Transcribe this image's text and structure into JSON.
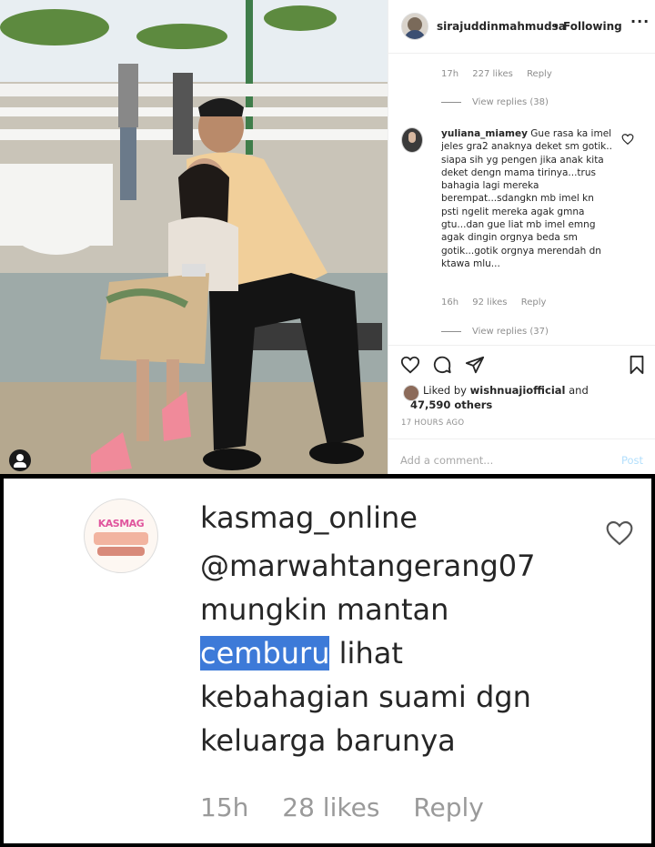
{
  "post": {
    "username": "sirajuddinmahmudsa",
    "separator": "•",
    "follow_status": "Following",
    "more_label": "···"
  },
  "thread": {
    "prev_comment_meta": {
      "time": "17h",
      "likes": "227 likes",
      "reply": "Reply"
    },
    "prev_view_replies": "View replies (38)",
    "comment": {
      "username": "yuliana_miamey",
      "text": "Gue rasa ka imel jeles gra2 anaknya deket sm gotik.. siapa sih yg pengen jika anak kita deket dengn mama tirinya...trus bahagia lagi mereka berempat...sdangkn mb imel kn psti ngelit mereka agak gmna gtu...dan gue liat mb imel emng agak dingin orgnya beda sm gotik...gotik orgnya merendah dn ktawa mlu...",
      "time": "16h",
      "likes": "92 likes",
      "reply": "Reply",
      "view_replies": "View replies (37)"
    }
  },
  "engagement": {
    "liked_prefix": "Liked by",
    "liked_user": "wishnuajiofficial",
    "liked_and": "and",
    "liked_others": "47,590 others",
    "timestamp": "17 HOURS AGO"
  },
  "composer": {
    "placeholder": "Add a comment...",
    "post_label": "Post"
  },
  "zoomed_comment": {
    "username": "kasmag_online",
    "avatar_text": "KASMAG",
    "mention": "@marwahtangerang07",
    "text_before": "mungkin mantan",
    "highlighted_word": "cemburu",
    "text_after_line": "lihat",
    "line3": "kebahagian suami dgn",
    "line4": "keluarga barunya",
    "time": "15h",
    "likes": "28 likes",
    "reply": "Reply"
  },
  "colors": {
    "text": "#262626",
    "muted": "#8e8e8e",
    "link_disabled": "#b2dffc",
    "highlight": "#3d7ad8"
  }
}
